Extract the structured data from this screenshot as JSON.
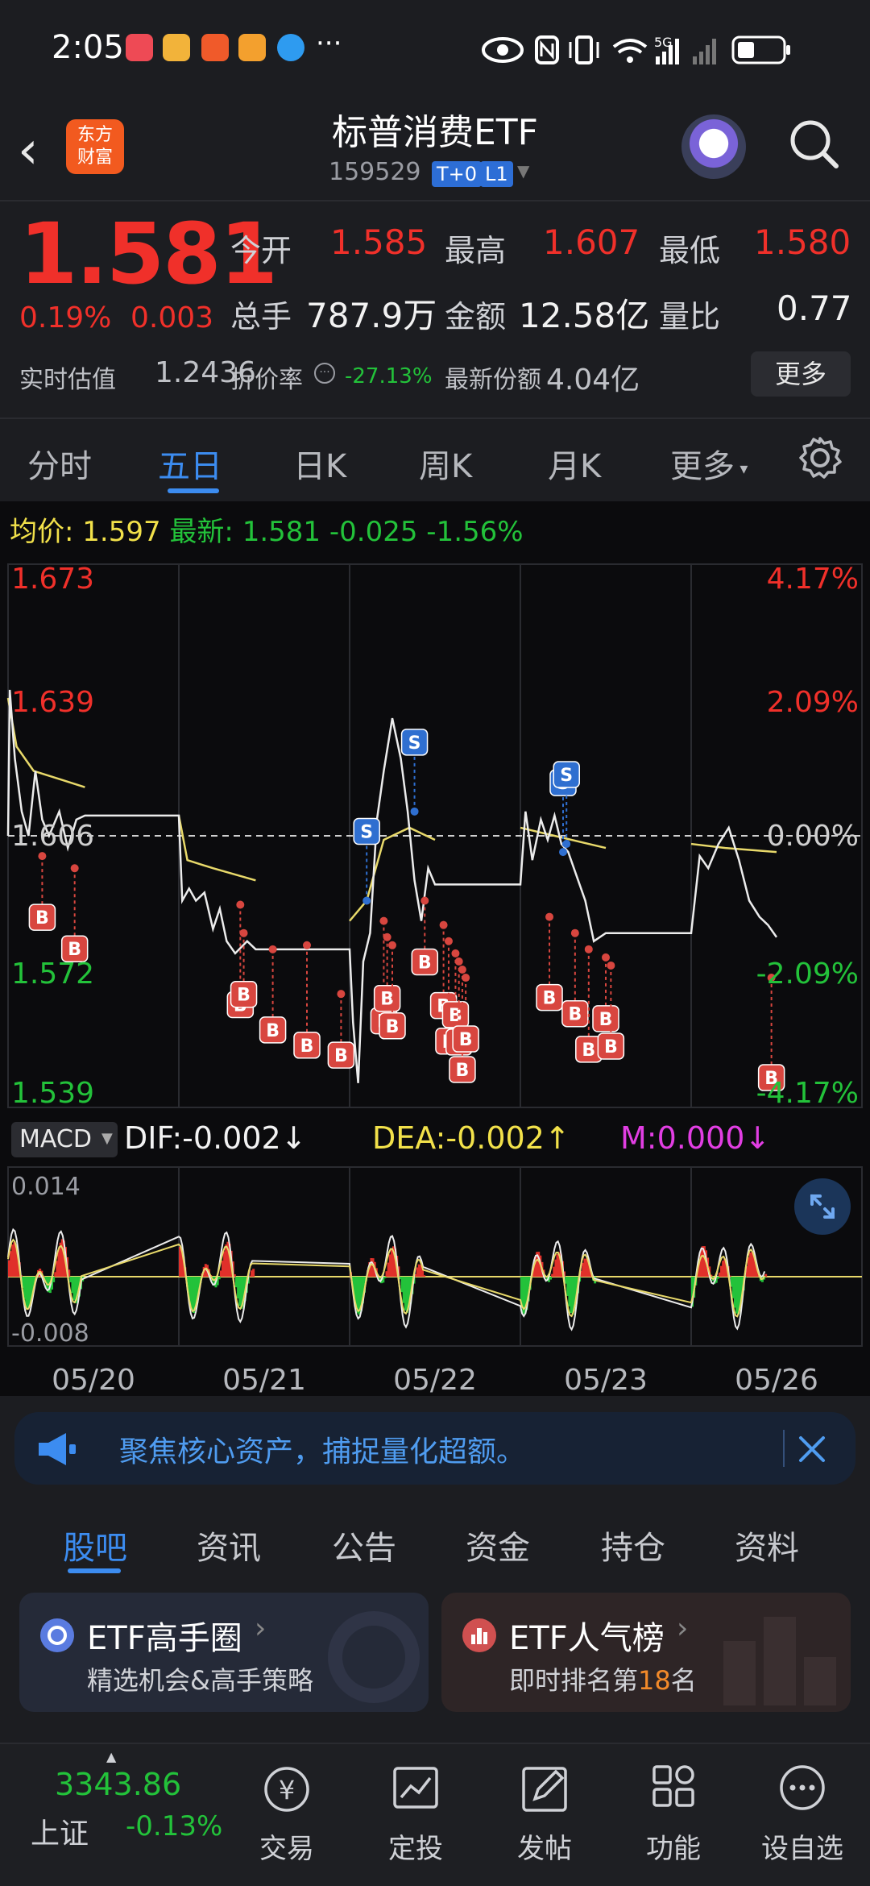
{
  "status_bar": {
    "time": "2:05",
    "more": "···",
    "network": "5G"
  },
  "header": {
    "back_icon": "chevron-left-icon",
    "logo_text_line1": "东方",
    "logo_text_line2": "财富",
    "title": "标普消费ETF",
    "code": "159529",
    "tag1": "T+0",
    "tag2": "L1"
  },
  "quote": {
    "price": "1.581",
    "change_pct": "0.19%",
    "change_abs": "0.003",
    "open_label": "今开",
    "open": "1.585",
    "high_label": "最高",
    "high": "1.607",
    "low_label": "最低",
    "low": "1.580",
    "volume_label": "总手",
    "volume": "787.9万",
    "amount_label": "金额",
    "amount": "12.58亿",
    "ratio_label": "量比",
    "ratio": "0.77",
    "iopv_label": "实时估值",
    "iopv": "1.2436",
    "discount_label": "折价率",
    "discount": "-27.13%",
    "shares_label": "最新份额",
    "shares": "4.04亿",
    "more_button": "更多"
  },
  "period_tabs": [
    "分时",
    "五日",
    "日K",
    "周K",
    "月K",
    "更多"
  ],
  "active_tab": "五日",
  "avg_bar": {
    "avg_label": "均价:",
    "avg_value": "1.597",
    "latest_label": "最新:",
    "latest_value": "1.581",
    "change": "-0.025",
    "change_pct": "-1.56%"
  },
  "chart_data": {
    "type": "line",
    "y_axis_left": [
      "1.673",
      "1.639",
      "1.606",
      "1.572",
      "1.539"
    ],
    "y_axis_right": [
      "4.17%",
      "2.09%",
      "0.00%",
      "-2.09%",
      "-4.17%"
    ],
    "ylim": [
      1.539,
      1.673
    ],
    "x_dates": [
      "05/20",
      "05/21",
      "05/22",
      "05/23",
      "05/26"
    ],
    "prev_close": 1.606,
    "price_series": [
      [
        0.0,
        1.606
      ],
      [
        0.01,
        1.642
      ],
      [
        0.04,
        1.625
      ],
      [
        0.08,
        1.612
      ],
      [
        0.12,
        1.606
      ],
      [
        0.16,
        1.622
      ],
      [
        0.2,
        1.61
      ],
      [
        0.24,
        1.606
      ],
      [
        0.3,
        1.612
      ],
      [
        0.35,
        1.603
      ],
      [
        0.4,
        1.61
      ],
      [
        0.45,
        1.611
      ],
      [
        1.0,
        1.611
      ],
      [
        1.02,
        1.59
      ],
      [
        1.06,
        1.593
      ],
      [
        1.1,
        1.59
      ],
      [
        1.15,
        1.592
      ],
      [
        1.2,
        1.583
      ],
      [
        1.24,
        1.588
      ],
      [
        1.28,
        1.58
      ],
      [
        1.33,
        1.577
      ],
      [
        1.4,
        1.58
      ],
      [
        1.45,
        1.578
      ],
      [
        2.0,
        1.578
      ],
      [
        2.02,
        1.56
      ],
      [
        2.05,
        1.545
      ],
      [
        2.08,
        1.575
      ],
      [
        2.12,
        1.582
      ],
      [
        2.16,
        1.61
      ],
      [
        2.2,
        1.622
      ],
      [
        2.25,
        1.635
      ],
      [
        2.3,
        1.625
      ],
      [
        2.34,
        1.612
      ],
      [
        2.38,
        1.595
      ],
      [
        2.42,
        1.585
      ],
      [
        2.46,
        1.598
      ],
      [
        2.5,
        1.594
      ],
      [
        3.0,
        1.594
      ],
      [
        3.03,
        1.612
      ],
      [
        3.07,
        1.6
      ],
      [
        3.12,
        1.61
      ],
      [
        3.16,
        1.605
      ],
      [
        3.2,
        1.611
      ],
      [
        3.24,
        1.604
      ],
      [
        3.28,
        1.602
      ],
      [
        3.33,
        1.596
      ],
      [
        3.38,
        1.59
      ],
      [
        3.43,
        1.58
      ],
      [
        3.5,
        1.582
      ],
      [
        4.0,
        1.582
      ],
      [
        4.05,
        1.601
      ],
      [
        4.1,
        1.598
      ],
      [
        4.16,
        1.604
      ],
      [
        4.22,
        1.608
      ],
      [
        4.28,
        1.6
      ],
      [
        4.34,
        1.59
      ],
      [
        4.4,
        1.586
      ],
      [
        4.45,
        1.584
      ],
      [
        4.5,
        1.581
      ]
    ],
    "avg_series": [
      [
        0.0,
        1.64
      ],
      [
        0.05,
        1.628
      ],
      [
        0.15,
        1.622
      ],
      [
        0.3,
        1.62
      ],
      [
        0.45,
        1.618
      ],
      [
        1.0,
        1.611
      ],
      [
        1.05,
        1.6
      ],
      [
        1.2,
        1.598
      ],
      [
        1.45,
        1.595
      ],
      [
        2.0,
        1.585
      ],
      [
        2.1,
        1.59
      ],
      [
        2.2,
        1.605
      ],
      [
        2.35,
        1.608
      ],
      [
        2.5,
        1.605
      ],
      [
        3.0,
        1.608
      ],
      [
        3.2,
        1.606
      ],
      [
        3.4,
        1.604
      ],
      [
        3.5,
        1.603
      ],
      [
        4.0,
        1.604
      ],
      [
        4.2,
        1.603
      ],
      [
        4.5,
        1.602
      ]
    ],
    "markers": [
      {
        "t": "B",
        "x": 0.2,
        "y": 1.601
      },
      {
        "t": "B",
        "x": 0.39,
        "y": 1.598
      },
      {
        "t": "B",
        "x": 1.36,
        "y": 1.589
      },
      {
        "t": "B",
        "x": 1.38,
        "y": 1.582
      },
      {
        "t": "B",
        "x": 1.55,
        "y": 1.578
      },
      {
        "t": "B",
        "x": 1.75,
        "y": 1.579
      },
      {
        "t": "B",
        "x": 1.95,
        "y": 1.567
      },
      {
        "t": "S",
        "x": 2.1,
        "y": 1.59
      },
      {
        "t": "B",
        "x": 2.2,
        "y": 1.585
      },
      {
        "t": "B",
        "x": 2.22,
        "y": 1.581
      },
      {
        "t": "B",
        "x": 2.25,
        "y": 1.579
      },
      {
        "t": "S",
        "x": 2.38,
        "y": 1.612
      },
      {
        "t": "B",
        "x": 2.44,
        "y": 1.59
      },
      {
        "t": "B",
        "x": 2.55,
        "y": 1.584
      },
      {
        "t": "B",
        "x": 2.58,
        "y": 1.58
      },
      {
        "t": "B",
        "x": 2.62,
        "y": 1.577
      },
      {
        "t": "B",
        "x": 2.64,
        "y": 1.575
      },
      {
        "t": "B",
        "x": 2.66,
        "y": 1.573
      },
      {
        "t": "B",
        "x": 2.68,
        "y": 1.571
      },
      {
        "t": "B",
        "x": 3.17,
        "y": 1.586
      },
      {
        "t": "S",
        "x": 3.25,
        "y": 1.602
      },
      {
        "t": "S",
        "x": 3.27,
        "y": 1.604
      },
      {
        "t": "B",
        "x": 3.32,
        "y": 1.582
      },
      {
        "t": "B",
        "x": 3.4,
        "y": 1.578
      },
      {
        "t": "B",
        "x": 3.5,
        "y": 1.576
      },
      {
        "t": "B",
        "x": 3.53,
        "y": 1.574
      },
      {
        "t": "B",
        "x": 4.47,
        "y": 1.571
      }
    ]
  },
  "macd": {
    "label": "MACD",
    "dif": "DIF:-0.002↓",
    "dea": "DEA:-0.002↑",
    "m": "M:0.000↓",
    "ymax": "0.014",
    "ymin": "-0.008"
  },
  "banner": {
    "text": "聚焦核心资产，捕捉量化超额。"
  },
  "bottom_tabs": [
    "股吧",
    "资讯",
    "公告",
    "资金",
    "持仓",
    "资料"
  ],
  "cards": [
    {
      "title": "ETF高手圈",
      "sub": "精选机会&高手策略"
    },
    {
      "title": "ETF人气榜",
      "sub_prefix": "即时排名第",
      "rank": "18",
      "sub_suffix": "名"
    }
  ],
  "bottom_nav": {
    "index_value": "3343.86",
    "index_name": "上证",
    "index_change": "-0.13%",
    "items": [
      "交易",
      "定投",
      "发帖",
      "功能",
      "设自选"
    ]
  },
  "colors": {
    "up": "#f0302a",
    "down": "#23c23a",
    "accent": "#3c8cf0",
    "avg": "#f2e14a"
  }
}
